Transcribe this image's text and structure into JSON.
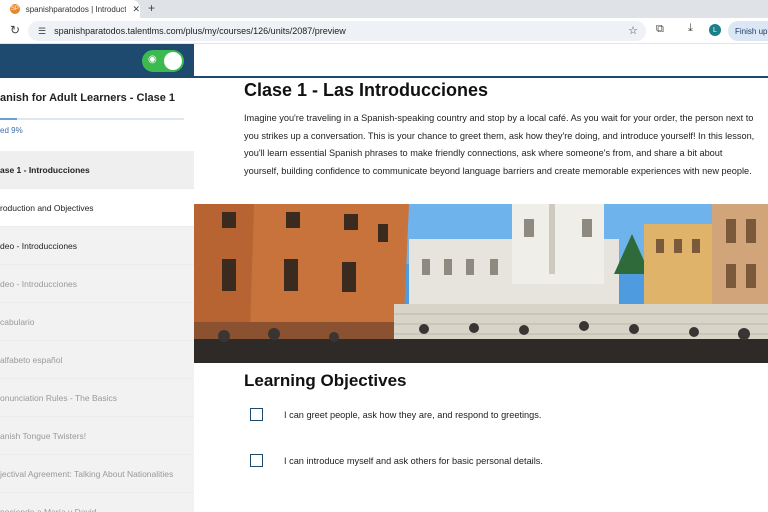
{
  "browser": {
    "tab_title": "spanishparatodos | Introducti",
    "tab_favicon": "SP",
    "url": "spanishparatodos.talentlms.com/plus/my/courses/126/units/2087/preview",
    "profile_initial": "L",
    "finish_button": "Finish up"
  },
  "sidebar": {
    "course_title": "anish for Adult Learners - Clase 1",
    "progress_percent": 9,
    "progress_text": "ed 9%",
    "units": [
      {
        "label": "ase 1 - Introducciones",
        "kind": "section"
      },
      {
        "label": "roduction and Objectives",
        "kind": "active"
      },
      {
        "label": "deo - Introducciones",
        "kind": "dark"
      },
      {
        "label": "deo - Introducciones",
        "kind": "locked"
      },
      {
        "label": "cabulario",
        "kind": "locked"
      },
      {
        "label": "alfabeto español",
        "kind": "locked"
      },
      {
        "label": "onunciation Rules - The Basics",
        "kind": "locked"
      },
      {
        "label": "anish Tongue Twisters!",
        "kind": "locked"
      },
      {
        "label": "jectival Agreement: Talking About Nationalities",
        "kind": "locked"
      },
      {
        "label": "nociendo a María y David",
        "kind": "locked"
      }
    ]
  },
  "main": {
    "title": "Clase 1 - Las Introducciones",
    "intro": "Imagine you're traveling in a Spanish-speaking country and stop by a local café. As you wait for your order, the person next to you strikes up a conversation. This is your chance to greet them, ask how they're doing, and introduce yourself! In this lesson, you'll learn essential Spanish phrases to make friendly connections, ask where someone's from, and share a bit about yourself, building confidence to communicate beyond language barriers and create memorable experiences with new people.",
    "objectives_heading": "Learning Objectives",
    "objectives": [
      "I can greet people, ask how they are, and respond to greetings.",
      "I can introduce myself and ask others for basic personal details."
    ]
  },
  "colors": {
    "brand_navy": "#1d4a6e",
    "toggle_green": "#3cb94f",
    "progress_blue": "#6aa0d8"
  }
}
